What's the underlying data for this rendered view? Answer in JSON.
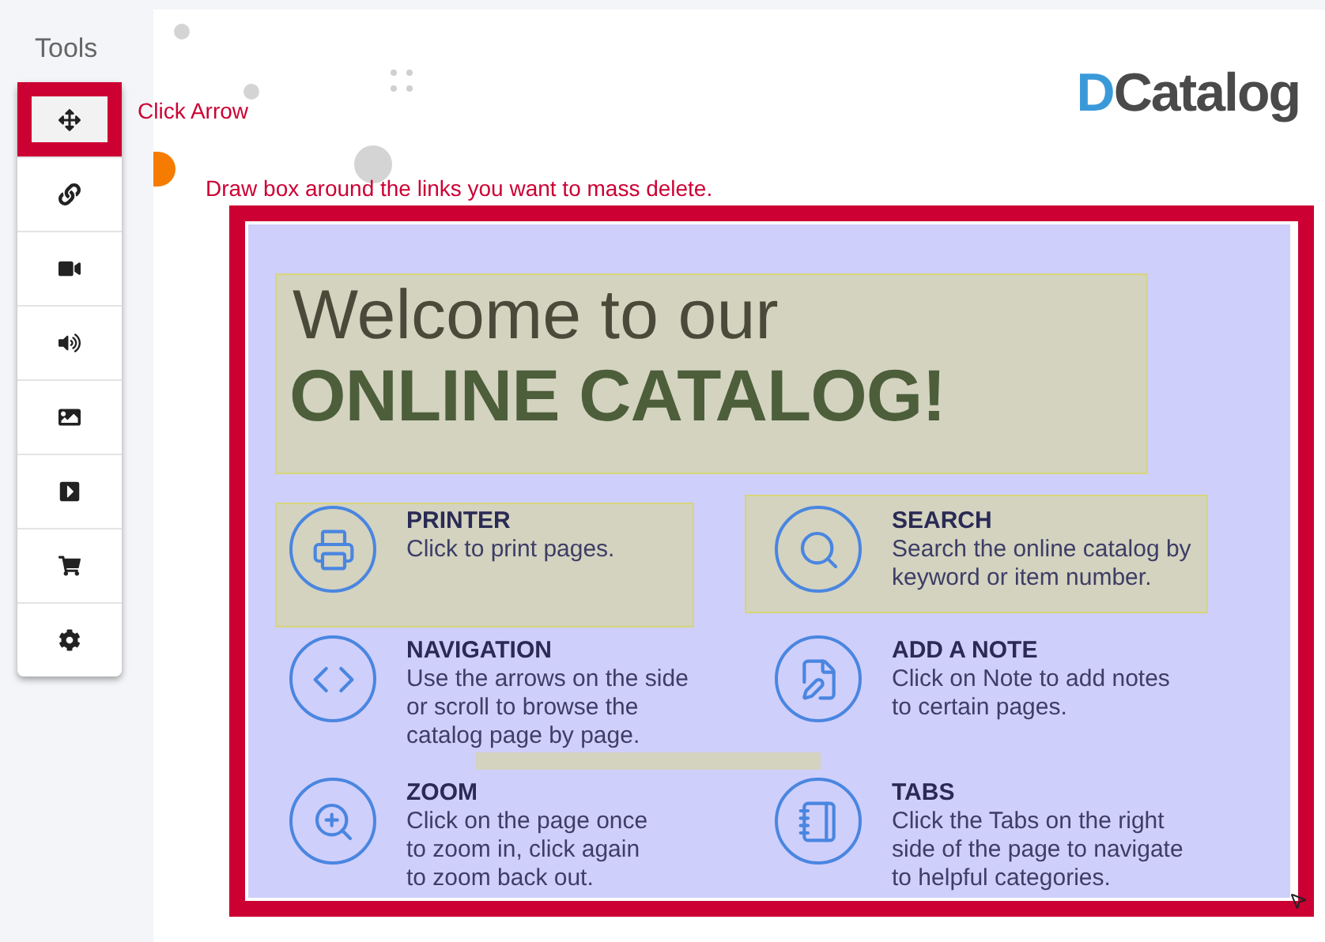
{
  "sidebar": {
    "title": "Tools",
    "tools": [
      {
        "kind": "move",
        "selected": true
      },
      {
        "kind": "link",
        "selected": false
      },
      {
        "kind": "video",
        "selected": false
      },
      {
        "kind": "audio",
        "selected": false
      },
      {
        "kind": "image",
        "selected": false
      },
      {
        "kind": "media",
        "selected": false
      },
      {
        "kind": "cart",
        "selected": false
      },
      {
        "kind": "settings",
        "selected": false
      }
    ]
  },
  "annotations": {
    "click_hint": "Click Arrow",
    "draw_hint": "Draw box around the links you want to mass delete."
  },
  "logo": {
    "mark": "D",
    "name": "Catalog"
  },
  "catalog_page": {
    "heading_light": "Welcome to our",
    "heading_bold": "ONLINE CATALOG!",
    "features": [
      {
        "kind": "printer",
        "title": "PRINTER",
        "lines": [
          "Click to print pages."
        ]
      },
      {
        "kind": "search",
        "title": "SEARCH",
        "lines": [
          "Search the online catalog by",
          "keyword or item number."
        ]
      },
      {
        "kind": "navigation",
        "title": "NAVIGATION",
        "lines": [
          "Use the arrows on the side",
          "or scroll to browse the",
          "catalog page by page."
        ]
      },
      {
        "kind": "note",
        "title": "ADD A NOTE",
        "lines": [
          "Click on Note to add notes",
          "to certain pages."
        ]
      },
      {
        "kind": "zoom",
        "title": "ZOOM",
        "lines": [
          "Click on the page once",
          "to zoom in, click again",
          "to zoom back out."
        ]
      },
      {
        "kind": "tabs",
        "title": "TABS",
        "lines": [
          "Click the Tabs on the right",
          "side of the page to navigate",
          "to helpful categories."
        ]
      }
    ]
  }
}
